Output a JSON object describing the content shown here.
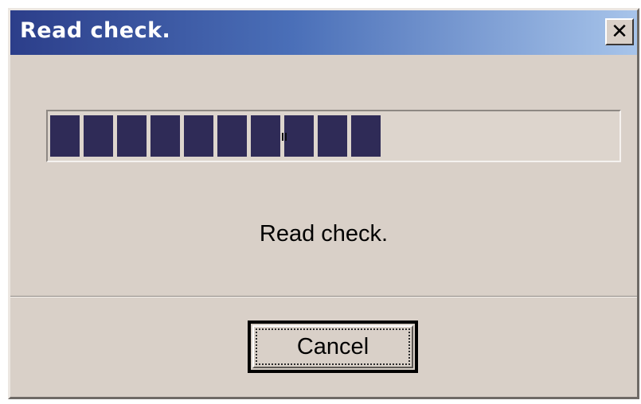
{
  "window": {
    "title": "Read check.",
    "close_glyph": "✕",
    "close_icon": "close-icon"
  },
  "progress": {
    "fraction": 0.57,
    "filled_blocks": 10,
    "bar_color": "#2f2b57"
  },
  "status": {
    "message": "Read check."
  },
  "buttons": {
    "cancel_label": "Cancel"
  },
  "colors": {
    "titlebar_start": "#2c3e8a",
    "titlebar_end": "#a7c4ea",
    "dialog_bg": "#d9d0c8"
  }
}
